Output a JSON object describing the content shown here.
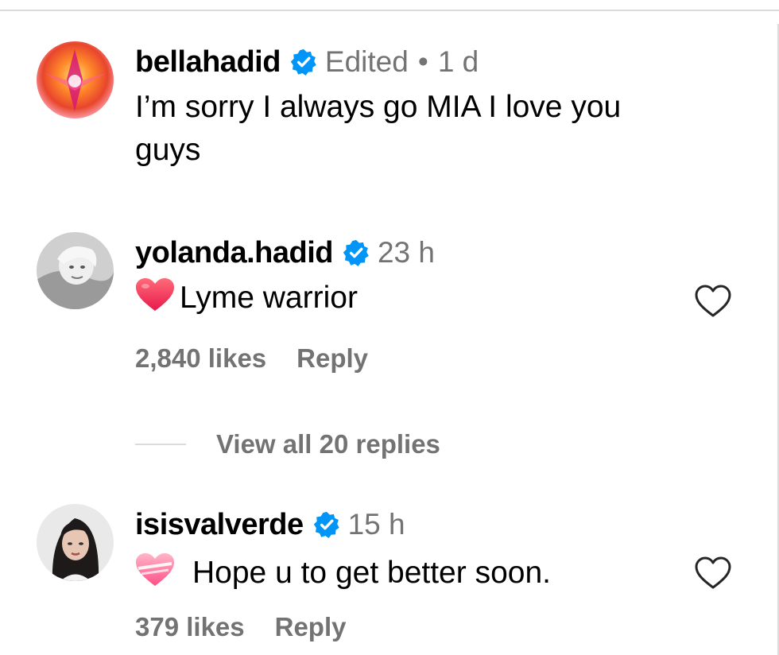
{
  "comments": [
    {
      "username": "bellahadid",
      "edited": "Edited",
      "time": "1 d",
      "text": "I’m sorry I always go MIA I love you guys",
      "avatar": "bellahadid-avatar"
    },
    {
      "username": "yolanda.hadid",
      "time": "23 h",
      "emoji": "red-heart-emoji",
      "text": "Lyme warrior",
      "likes": "2,840 likes",
      "reply": "Reply",
      "view_replies": "View all 20 replies"
    },
    {
      "username": "isisvalverde",
      "time": "15 h",
      "emoji": "pink-heart-emoji",
      "text": "Hope u to get better soon.",
      "likes": "379 likes",
      "reply": "Reply"
    }
  ],
  "colors": {
    "verified_blue": "#0095f6",
    "meta_gray": "#737373",
    "divider": "#dbdbdb"
  }
}
